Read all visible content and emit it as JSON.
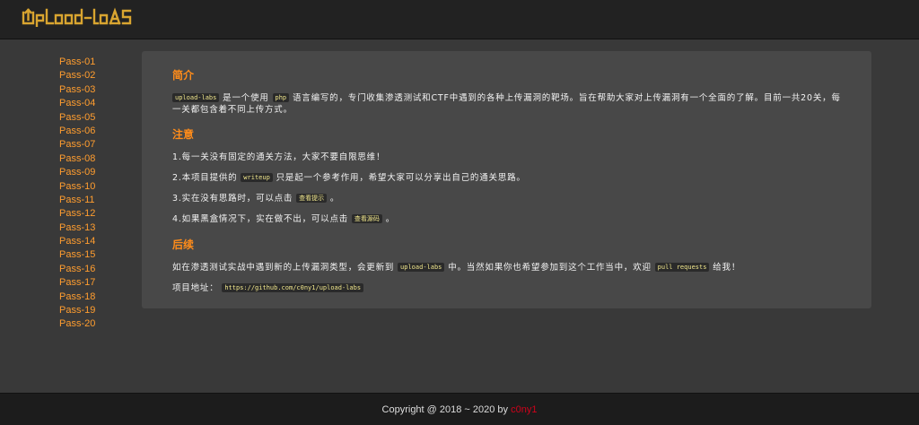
{
  "header": {
    "logo_text": "Upload-labs"
  },
  "sidebar": {
    "items": [
      "Pass-01",
      "Pass-02",
      "Pass-03",
      "Pass-04",
      "Pass-05",
      "Pass-06",
      "Pass-07",
      "Pass-08",
      "Pass-09",
      "Pass-10",
      "Pass-11",
      "Pass-12",
      "Pass-13",
      "Pass-14",
      "Pass-15",
      "Pass-16",
      "Pass-17",
      "Pass-18",
      "Pass-19",
      "Pass-20"
    ]
  },
  "intro": {
    "title": "简介",
    "code1": "upload-labs",
    "t1": " 是一个使用 ",
    "code2": "php",
    "t2": " 语言编写的，专门收集渗透测试和CTF中遇到的各种上传漏洞的靶场。旨在帮助大家对上传漏洞有一个全面的了解。目前一共20关，每一关都包含着不同上传方式。"
  },
  "notes": {
    "title": "注意",
    "item1": "1.每一关没有固定的通关方法，大家不要自限思维！",
    "item2_a": "2.本项目提供的 ",
    "item2_code": "writeup",
    "item2_b": " 只是起一个参考作用，希望大家可以分享出自己的通关思路。",
    "item3_a": "3.实在没有思路时，可以点击 ",
    "item3_btn": "查看提示",
    "item3_b": " 。",
    "item4_a": "4.如果黑盒情况下，实在做不出，可以点击 ",
    "item4_btn": "查看源码",
    "item4_b": " 。"
  },
  "followup": {
    "title": "后续",
    "t1": "如在渗透测试实战中遇到新的上传漏洞类型，会更新到 ",
    "code1": "upload-labs",
    "t2": " 中。当然如果你也希望参加到这个工作当中，欢迎 ",
    "code2": "pull requests",
    "t3": " 给我！",
    "addr_label": "项目地址：",
    "addr_url": "https://github.com/c0ny1/upload-labs"
  },
  "footer": {
    "text": "Copyright @ 2018 ~ 2020 by ",
    "author": "c0ny1"
  }
}
